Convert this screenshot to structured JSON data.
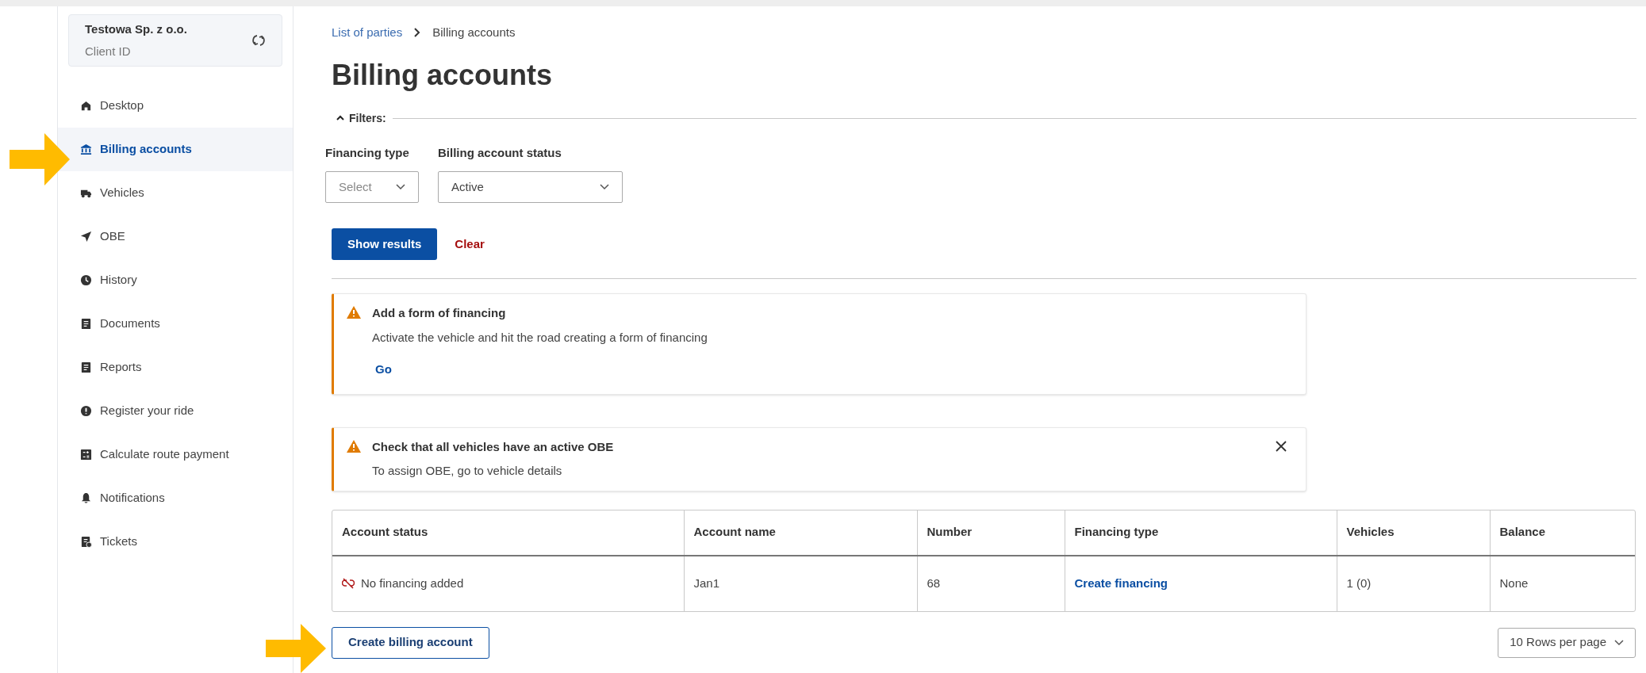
{
  "sidebar": {
    "client": {
      "name": "Testowa Sp. z o.o.",
      "id_label": "Client ID"
    },
    "items": [
      {
        "label": "Desktop",
        "selected": false
      },
      {
        "label": "Billing accounts",
        "selected": true
      },
      {
        "label": "Vehicles",
        "selected": false
      },
      {
        "label": "OBE",
        "selected": false
      },
      {
        "label": "History",
        "selected": false
      },
      {
        "label": "Documents",
        "selected": false
      },
      {
        "label": "Reports",
        "selected": false
      },
      {
        "label": "Register your ride",
        "selected": false
      },
      {
        "label": "Calculate route payment",
        "selected": false
      },
      {
        "label": "Notifications",
        "selected": false
      },
      {
        "label": "Tickets",
        "selected": false
      }
    ]
  },
  "breadcrumb": [
    "List of parties",
    "Billing accounts"
  ],
  "title": "Billing accounts",
  "filters": {
    "label": "Filters:",
    "expanded": true,
    "fields": [
      {
        "label": "Financing type",
        "placeholder": "Select"
      },
      {
        "label": "Billing account status",
        "value": "Active"
      }
    ],
    "apply": "Show results",
    "clear": "Clear"
  },
  "alerts": [
    {
      "title": "Add a form of financing",
      "text": "Activate the vehicle and hit the road creating a form of financing",
      "link": "Go",
      "closable": false
    },
    {
      "title": "Check that all vehicles have an active OBE",
      "text": "To assign OBE, go to vehicle details",
      "closable": true
    }
  ],
  "table": {
    "columns": [
      "Account status",
      "Account name",
      "Number",
      "Financing type",
      "Vehicles",
      "Balance"
    ],
    "rows": [
      [
        "No financing added",
        "Jan1",
        "68",
        "Create financing",
        "1 (0)",
        "None"
      ]
    ]
  },
  "create_button": "Create billing account",
  "rows_per_page": "10 Rows per page"
}
